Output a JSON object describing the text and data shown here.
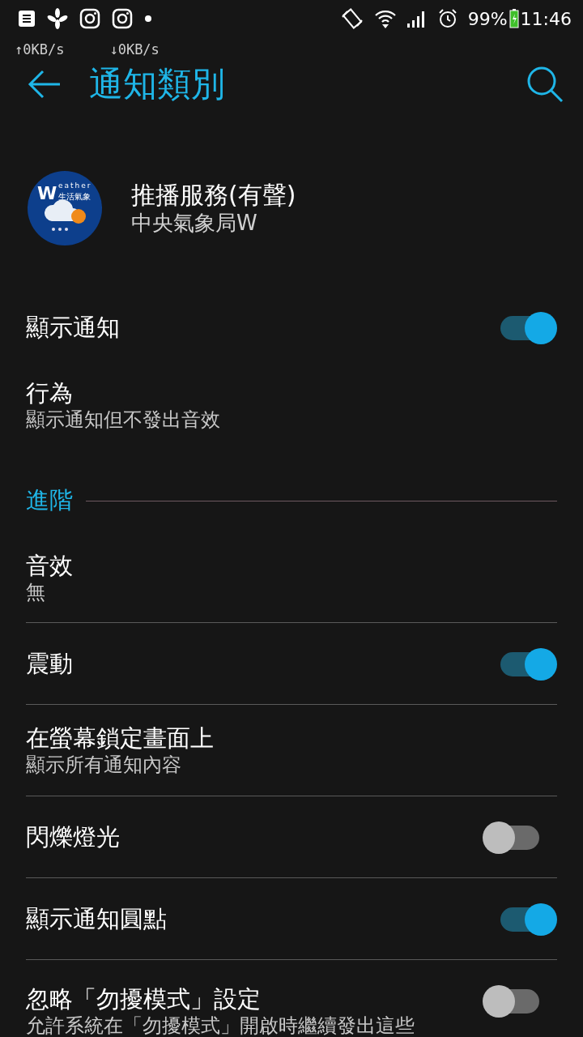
{
  "status_bar": {
    "battery": "99%",
    "time": "11:46",
    "upload": "↑0KB/s",
    "download": "↓0KB/s"
  },
  "app_bar": {
    "title": "通知類別"
  },
  "app_header": {
    "logo": {
      "initial": "W",
      "word": "eather",
      "subtitle": "生活氣象"
    },
    "title": "推播服務(有聲)",
    "app_name": "中央氣象局W"
  },
  "items": [
    {
      "kind": "toggle",
      "title": "顯示通知",
      "on": true
    },
    {
      "kind": "text",
      "title": "行為",
      "subtitle": "顯示通知但不發出音效"
    }
  ],
  "advanced": {
    "title": "進階",
    "items": [
      {
        "kind": "text",
        "title": "音效",
        "subtitle": "無"
      },
      {
        "kind": "toggle",
        "title": "震動",
        "on": true
      },
      {
        "kind": "text",
        "title": "在螢幕鎖定畫面上",
        "subtitle": "顯示所有通知內容"
      },
      {
        "kind": "toggle",
        "title": "閃爍燈光",
        "on": false
      },
      {
        "kind": "toggle",
        "title": "顯示通知圓點",
        "on": true
      },
      {
        "kind": "toggle",
        "title": "忽略「勿擾模式」設定",
        "subtitle": "允許系統在「勿擾模式」開啟時繼續發出這些",
        "on": false
      }
    ]
  }
}
